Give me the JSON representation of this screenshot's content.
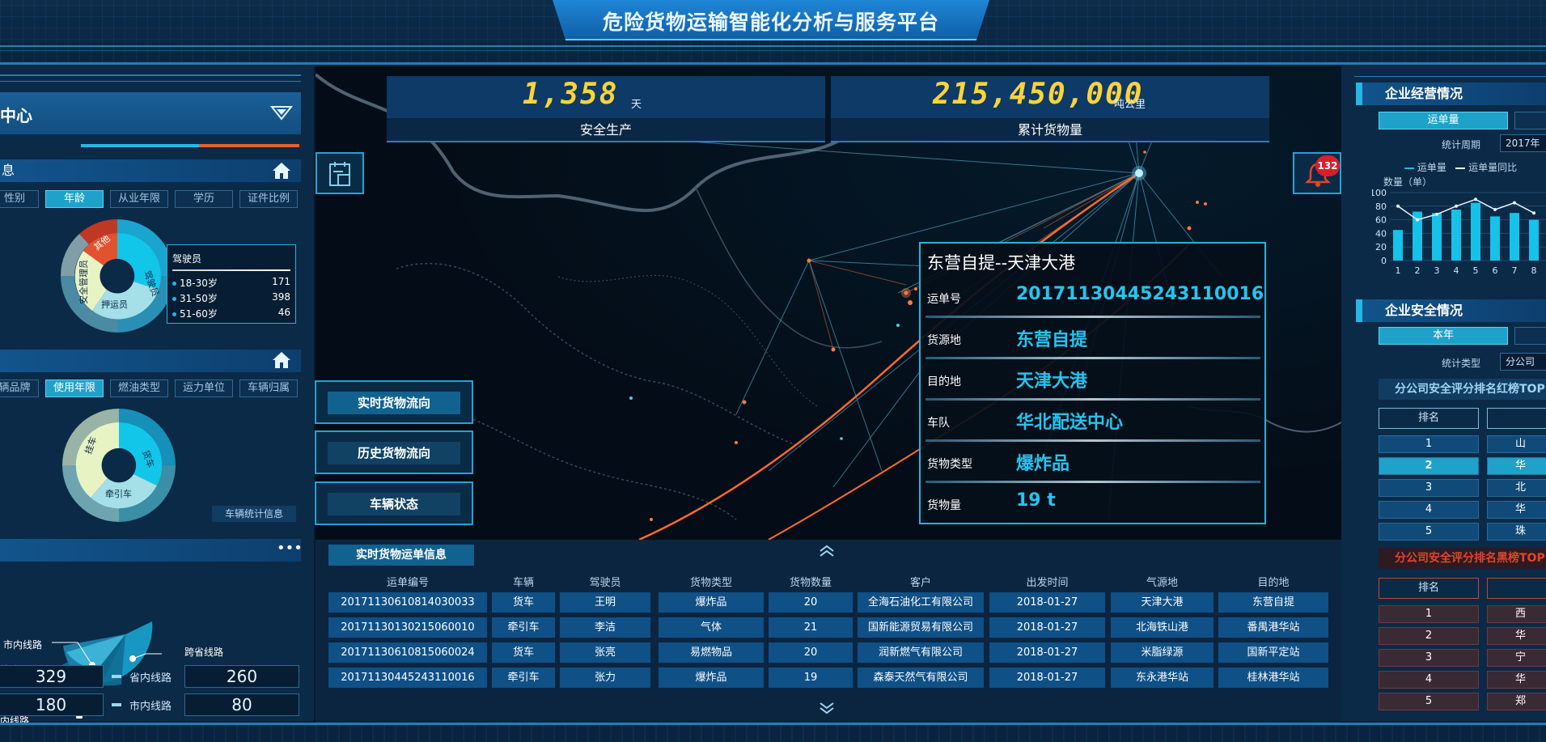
{
  "header": {
    "title": "危险货物运输智能化分析与服务平台"
  },
  "left_panel": {
    "center_dropdown": {
      "value": "中心"
    },
    "section_info": {
      "title": "息"
    },
    "tabs_person": [
      {
        "label": "性别",
        "active": false
      },
      {
        "label": "年龄",
        "active": true
      },
      {
        "label": "从业年限",
        "active": false
      },
      {
        "label": "学历",
        "active": false
      },
      {
        "label": "证件比例",
        "active": false
      }
    ],
    "donut_person": {
      "segments": [
        "其他",
        "驾驶员",
        "押运员",
        "安全管理员"
      ]
    },
    "driver_legend": {
      "title": "驾驶员",
      "rows": [
        {
          "label": "18-30岁",
          "value": "171"
        },
        {
          "label": "31-50岁",
          "value": "398"
        },
        {
          "label": "51-60岁",
          "value": "46"
        }
      ]
    },
    "tabs_vehicle": [
      {
        "label": "辆品牌",
        "active": false
      },
      {
        "label": "使用年限",
        "active": true
      },
      {
        "label": "燃油类型",
        "active": false
      },
      {
        "label": "运力单位",
        "active": false
      },
      {
        "label": "车辆归属",
        "active": false
      }
    ],
    "donut_vehicle": {
      "segments": [
        "挂车",
        "货车",
        "牵引车"
      ]
    },
    "vehicle_stat_button": "车辆统计信息",
    "routes": {
      "labels": [
        "市内线路",
        "线路",
        "跨省线路",
        "内线路"
      ]
    },
    "route_stats": [
      {
        "left_value": "329",
        "label": "省内线路",
        "right_value": "260"
      },
      {
        "left_value": "180",
        "label": "市内线路",
        "right_value": "80"
      }
    ]
  },
  "kpis": [
    {
      "value": "1,358",
      "unit": "天",
      "label": "安全生产"
    },
    {
      "value": "215,450,000",
      "unit": "吨公里",
      "label": "累计货物量"
    }
  ],
  "alarm_count": "132",
  "map_buttons": [
    "实时货物流向",
    "历史货物流向",
    "车辆状态"
  ],
  "waybill_popup": {
    "title": "东营自提--天津大港",
    "rows": [
      {
        "label": "运单号",
        "value": "20171130445243110016"
      },
      {
        "label": "货源地",
        "value": "东营自提"
      },
      {
        "label": "目的地",
        "value": "天津大港"
      },
      {
        "label": "车队",
        "value": "华北配送中心"
      },
      {
        "label": "货物类型",
        "value": "爆炸品"
      },
      {
        "label": "货物量",
        "value": "19    t"
      }
    ]
  },
  "waybill_table": {
    "title": "实时货物运单信息",
    "columns": [
      "运单编号",
      "车辆",
      "驾驶员",
      "货物类型",
      "货物数量",
      "客户",
      "出发时间",
      "气源地",
      "目的地"
    ],
    "rows": [
      [
        "20171130610814030033",
        "货车",
        "王明",
        "爆炸品",
        "20",
        "全海石油化工有限公司",
        "2018-01-27",
        "天津大港",
        "东营自提"
      ],
      [
        "20171130130215060010",
        "牵引车",
        "李洁",
        "气体",
        "21",
        "国新能源贸易有限公司",
        "2018-01-27",
        "北海铁山港",
        "番禺港华站"
      ],
      [
        "20171130610815060024",
        "货车",
        "张亮",
        "易燃物品",
        "20",
        "润新燃气有限公司",
        "2018-01-27",
        "米脂绿源",
        "国新平定站"
      ],
      [
        "20171130445243110016",
        "牵引车",
        "张力",
        "爆炸品",
        "19",
        "森泰天然气有限公司",
        "2018-01-27",
        "东永港华站",
        "桂林港华站"
      ]
    ]
  },
  "right_panel": {
    "business": {
      "title": "企业经营情况",
      "tab": "运单量",
      "period_label": "统计周期",
      "period_value": "2017年"
    },
    "chart_data": {
      "type": "bar",
      "ylabel": "数量（单）",
      "ylim": [
        0,
        100
      ],
      "yticks": [
        "100",
        "80",
        "60",
        "40",
        "20",
        "0"
      ],
      "categories": [
        "1",
        "2",
        "3",
        "4",
        "5",
        "6",
        "7",
        "8"
      ],
      "series": [
        {
          "name": "运单量",
          "values": [
            45,
            72,
            70,
            75,
            85,
            65,
            70,
            60
          ]
        },
        {
          "name": "运单量同比",
          "values": [
            80,
            60,
            68,
            80,
            90,
            75,
            85,
            70
          ]
        }
      ]
    },
    "safety": {
      "title": "企业安全情况",
      "tab": "本年",
      "type_label": "统计类型",
      "type_value": "分公司"
    },
    "red_list": {
      "title": "分公司安全评分排名红榜TOP",
      "header": "排名",
      "ranks": [
        "1",
        "2",
        "3",
        "4",
        "5"
      ],
      "names": [
        "山",
        "华",
        "北",
        "华",
        "珠"
      ]
    },
    "black_list": {
      "title": "分公司安全评分排名黑榜TOP",
      "header": "排名",
      "ranks": [
        "1",
        "2",
        "3",
        "4",
        "5"
      ],
      "names": [
        "西",
        "华",
        "宁",
        "华",
        "郑"
      ]
    }
  },
  "colors": {
    "accent": "#26c4ee",
    "kpi": "#ffd33a",
    "panel": "#0b2a47",
    "danger": "#e2452b"
  }
}
